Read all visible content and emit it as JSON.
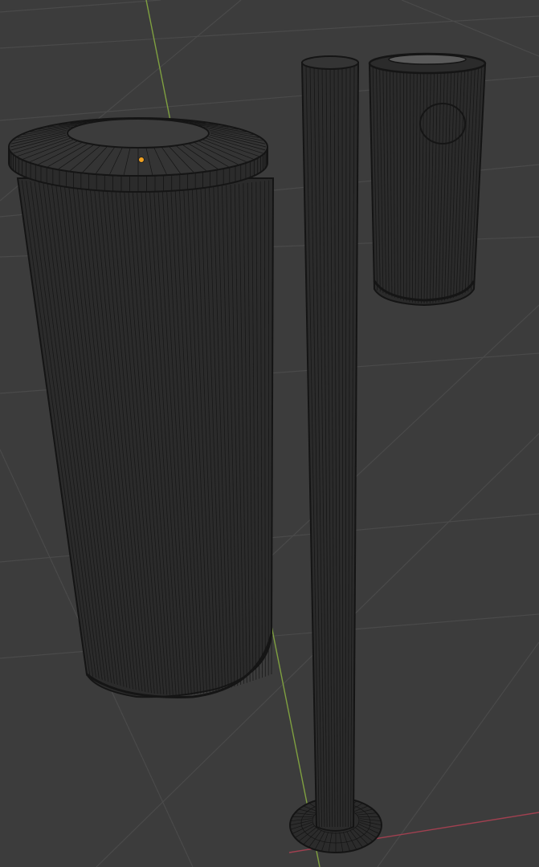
{
  "viewport": {
    "view": "3d-viewport-wireframe",
    "colors": {
      "background": "#3c3c3c",
      "grid_line": "#4a4a4a",
      "x_axis": "#a04050",
      "y_axis": "#7fa040",
      "mesh_fill": "#2b2b2b",
      "mesh_cap": "#343434",
      "wire": "#151515",
      "origin_point": "#f0a020"
    }
  },
  "objects": [
    {
      "name": "large-cylinder-bin"
    },
    {
      "name": "pole"
    },
    {
      "name": "small-cylinder-bin"
    },
    {
      "name": "pole-base"
    }
  ]
}
